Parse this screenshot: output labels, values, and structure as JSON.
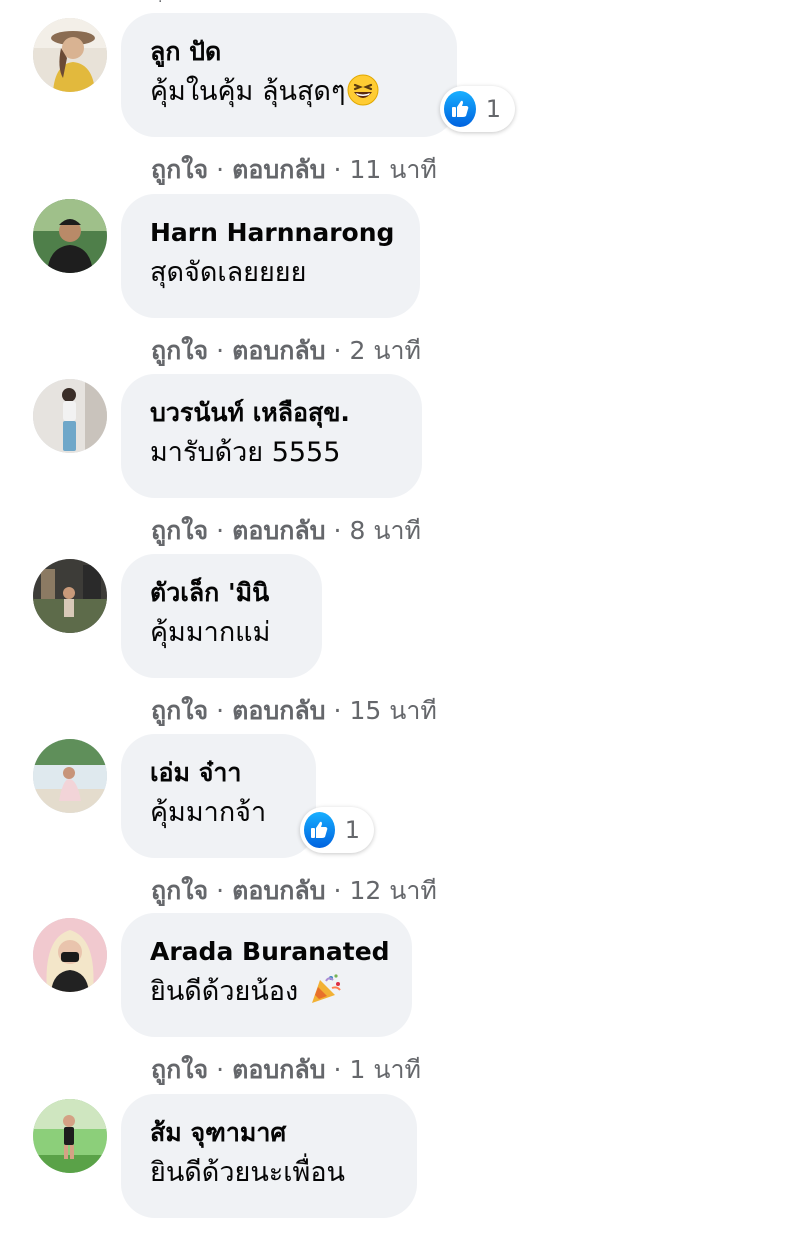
{
  "colors": {
    "bubble_bg": "#f0f2f5",
    "text": "#050505",
    "meta": "#65676b",
    "like_blue": "#1877f2"
  },
  "comments": [
    {
      "author": "ลูก ปัด",
      "text": "คุ้มในคุ้ม ลุ้นสุดๆ",
      "emoji": "grinning-squinting-face",
      "reaction_count": "1",
      "like_label": "ถูกใจ",
      "reply_label": "ตอบกลับ",
      "time": "11 นาที"
    },
    {
      "author": "Harn Harnnarong",
      "text": "สุดจัดเลยยยย",
      "like_label": "ถูกใจ",
      "reply_label": "ตอบกลับ",
      "time": "2 นาที"
    },
    {
      "author": "บวรนันท์ เหลือสุข.",
      "text": "มารับด้วย 5555",
      "like_label": "ถูกใจ",
      "reply_label": "ตอบกลับ",
      "time": "8 นาที"
    },
    {
      "author": "ตัวเล็ก 'มินิ",
      "text": "คุ้มมากแม่",
      "like_label": "ถูกใจ",
      "reply_label": "ตอบกลับ",
      "time": "15 นาที"
    },
    {
      "author": "เอ่ม จ๋าา",
      "text": "คุ้มมากจ้า",
      "reaction_count": "1",
      "like_label": "ถูกใจ",
      "reply_label": "ตอบกลับ",
      "time": "12 นาที"
    },
    {
      "author": "Arada Buranated",
      "text": "ยินดีด้วยน้อง",
      "emoji": "party-popper",
      "like_label": "ถูกใจ",
      "reply_label": "ตอบกลับ",
      "time": "1 นาที"
    },
    {
      "author": "ส้ม จุฑามาศ",
      "text": "ยินดีด้วยนะเพื่อน"
    }
  ],
  "separator": "·"
}
